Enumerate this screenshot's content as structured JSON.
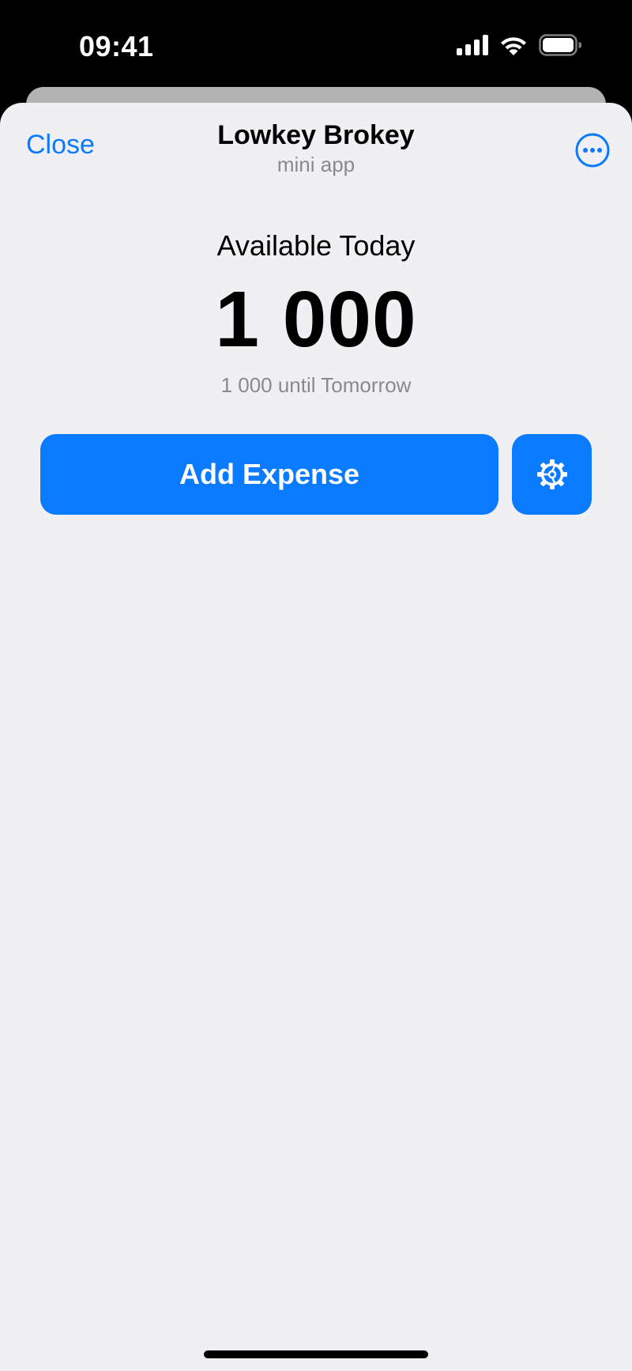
{
  "status_bar": {
    "time": "09:41",
    "icons": [
      "cellular-signal-icon",
      "wifi-icon",
      "battery-icon"
    ]
  },
  "nav": {
    "close_label": "Close",
    "title": "Lowkey Brokey",
    "subtitle": "mini app",
    "more_icon": "ellipsis-circle-icon"
  },
  "balance": {
    "label": "Available Today",
    "amount": "1 000",
    "note": "1 000 until Tomorrow"
  },
  "actions": {
    "add_expense_label": "Add Expense",
    "settings_icon": "gear-icon"
  },
  "colors": {
    "accent": "#0a7aff",
    "sheet_background": "#efeff4",
    "secondary_text": "#8a8a8e",
    "status_bar_background": "#000000"
  }
}
